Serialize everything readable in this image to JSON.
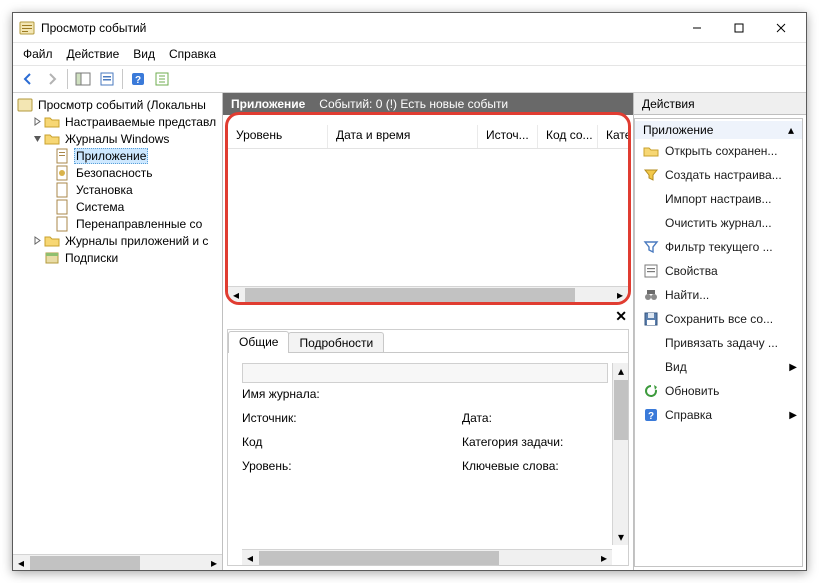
{
  "window": {
    "title": "Просмотр событий"
  },
  "menu": {
    "file": "Файл",
    "action": "Действие",
    "view": "Вид",
    "help": "Справка"
  },
  "tree": {
    "root": "Просмотр событий (Локальны",
    "custom": "Настраиваемые представл",
    "winlogs": "Журналы Windows",
    "winlogs_children": {
      "app": "Приложение",
      "security": "Безопасность",
      "setup": "Установка",
      "system": "Система",
      "forwarded": "Перенаправленные со"
    },
    "applogs": "Журналы приложений и с",
    "subs": "Подписки"
  },
  "center": {
    "header_title": "Приложение",
    "header_info": "Событий: 0 (!) Есть новые событи",
    "columns": {
      "level": "Уровень",
      "datetime": "Дата и время",
      "source": "Источ...",
      "code": "Код со...",
      "category": "Катег"
    },
    "tabs": {
      "general": "Общие",
      "details": "Подробности"
    },
    "fields": {
      "logname": "Имя журнала:",
      "source": "Источник:",
      "date": "Дата:",
      "code": "Код",
      "taskcat": "Категория задачи:",
      "level": "Уровень:",
      "keywords": "Ключевые слова:"
    }
  },
  "actions": {
    "title": "Действия",
    "group": "Приложение",
    "items": {
      "open_saved": "Открыть сохранен...",
      "create_custom": "Создать настраива...",
      "import_custom": "Импорт настраив...",
      "clear_log": "Очистить журнал...",
      "filter": "Фильтр текущего ...",
      "properties": "Свойства",
      "find": "Найти...",
      "save_all": "Сохранить все со...",
      "attach_task": "Привязать задачу ...",
      "view": "Вид",
      "refresh": "Обновить",
      "help": "Справка"
    }
  }
}
